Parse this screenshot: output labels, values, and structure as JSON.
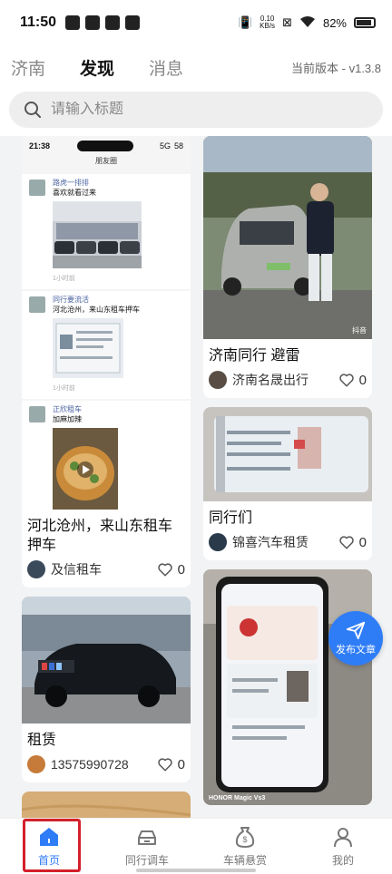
{
  "status_bar": {
    "time": "11:50",
    "net_speed_value": "0.10",
    "net_speed_unit": "KB/s",
    "battery": "82%"
  },
  "top_nav": {
    "tabs": [
      {
        "label": "济南"
      },
      {
        "label": "发现"
      },
      {
        "label": "消息"
      }
    ],
    "version": "当前版本 - v1.3.8"
  },
  "search": {
    "placeholder": "请输入标题"
  },
  "feed": {
    "left": [
      {
        "title": "河北沧州，来山东租车押车",
        "author": "及信租车",
        "likes": "0",
        "inner": {
          "time": "21:38",
          "signal": "5G",
          "battery_level": "58",
          "header": "朋友圈",
          "posts": [
            {
              "name": "路虎一排排",
              "text": "喜欢就看过来",
              "time": "1小时前"
            },
            {
              "name": "同行要流活",
              "text": "河北沧州，来山东租车押车",
              "time": "1小时前"
            },
            {
              "name": "正欣租车",
              "text": "加麻加辣",
              "time": ""
            }
          ]
        }
      },
      {
        "title": "租赁",
        "author": "13575990728",
        "likes": "0"
      },
      {
        "title": "",
        "author": "",
        "likes": ""
      }
    ],
    "right": [
      {
        "title": "济南同行 避雷",
        "author": "济南名晟出行",
        "likes": "0",
        "badge": "抖音"
      },
      {
        "title": "同行们",
        "author": "锦喜汽车租赁",
        "likes": "0"
      },
      {
        "title": "",
        "author": "",
        "likes": "",
        "caption": "HONOR Magic Vs3"
      }
    ]
  },
  "fab": {
    "label": "发布文章"
  },
  "tab_bar": {
    "items": [
      {
        "label": "首页"
      },
      {
        "label": "同行调车"
      },
      {
        "label": "车辆悬赏"
      },
      {
        "label": "我的"
      }
    ]
  },
  "colors": {
    "accent": "#2f7df6",
    "highlight": "#d3202a"
  }
}
